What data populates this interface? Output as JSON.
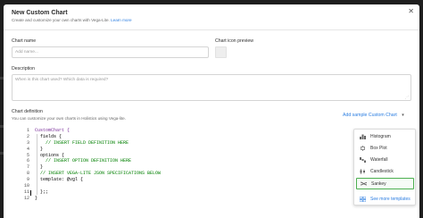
{
  "modal": {
    "title": "New Custom Chart",
    "subtitle": "Create and customize your own charts with Vega-Lite.",
    "learn_more": "Learn more"
  },
  "form": {
    "chart_name_label": "Chart name",
    "chart_name_placeholder": "Add name...",
    "icon_preview_label": "Chart icon preview",
    "description_label": "Description",
    "description_placeholder": "When is this chart used? Which data is required?",
    "definition_label": "Chart definition",
    "definition_help": "You can customize your own charts in Holistics using Vega-lite.",
    "add_sample_label": "Add sample Custom Chart"
  },
  "editor": {
    "line_numbers": [
      "1",
      "2",
      "3",
      "4",
      "5",
      "6",
      "7",
      "8",
      "9",
      "10",
      "11",
      "12"
    ],
    "lines": [
      "CustomChart {",
      "  fields {",
      "    // INSERT FIELD DEFINITION HERE",
      "  }",
      "  options {",
      "    // INSERT OPTION DEFINITION HERE",
      "  }",
      "  // INSERT VEGA-LITE JSON SPECIFICATIONS BELOW",
      "  template: @vgl {",
      "",
      "  };;",
      "}"
    ]
  },
  "dropdown": {
    "items": [
      {
        "label": "Histogram",
        "icon": "histogram-icon"
      },
      {
        "label": "Box Plot",
        "icon": "box-plot-icon"
      },
      {
        "label": "Waterfall",
        "icon": "waterfall-icon"
      },
      {
        "label": "Candlestick",
        "icon": "candlestick-icon"
      },
      {
        "label": "Sankey",
        "icon": "sankey-icon"
      }
    ],
    "more_label": "See more templates"
  },
  "colors": {
    "accent": "#2a7de1",
    "selected_border": "#4caf50",
    "comment": "#008000",
    "keyword": "#7a2e9a",
    "backdrop": "#1e1e1e"
  }
}
